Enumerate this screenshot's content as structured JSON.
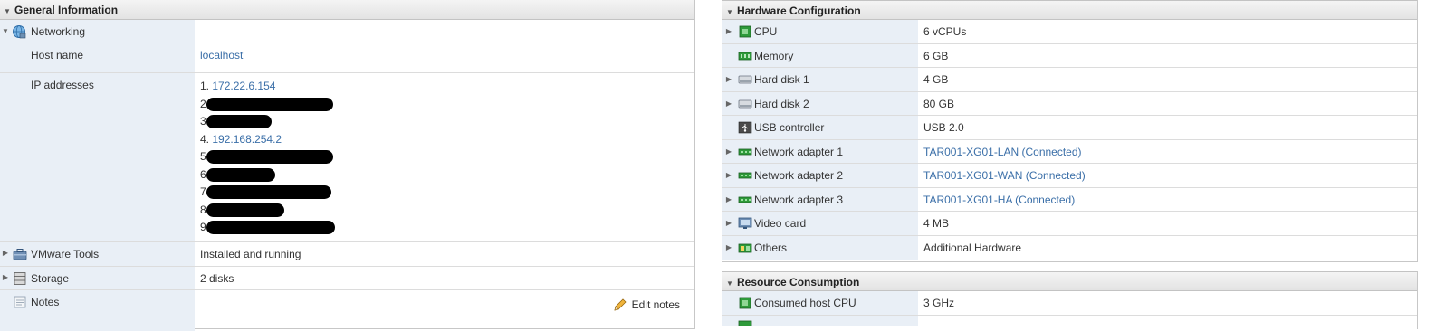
{
  "general": {
    "title": "General Information",
    "networking_label": "Networking",
    "host_name_label": "Host name",
    "host_name_value": "localhost",
    "ip_label": "IP addresses",
    "ip_prefixes": [
      "1.",
      "2.",
      "3.",
      "4.",
      "5.",
      "6.",
      "7.",
      "8.",
      "9."
    ],
    "ip_values": [
      "172.22.6.154",
      "",
      "",
      "192.168.254.2",
      "",
      "",
      "",
      "",
      ""
    ],
    "vmware_tools_label": "VMware Tools",
    "vmware_tools_value": "Installed and running",
    "storage_label": "Storage",
    "storage_value": "2 disks",
    "notes_label": "Notes",
    "edit_notes": "Edit notes"
  },
  "hardware": {
    "title": "Hardware Configuration",
    "rows": [
      {
        "label": "CPU",
        "value": "6 vCPUs",
        "icon": "cpu-icon",
        "expand": true,
        "link": false
      },
      {
        "label": "Memory",
        "value": "6 GB",
        "icon": "memory-icon",
        "expand": false,
        "link": false
      },
      {
        "label": "Hard disk 1",
        "value": "4 GB",
        "icon": "hard-disk-icon",
        "expand": true,
        "link": false
      },
      {
        "label": "Hard disk 2",
        "value": "80 GB",
        "icon": "hard-disk-icon",
        "expand": true,
        "link": false
      },
      {
        "label": "USB controller",
        "value": "USB 2.0",
        "icon": "usb-icon",
        "expand": false,
        "link": false
      },
      {
        "label": "Network adapter 1",
        "value": "TAR001-XG01-LAN (Connected)",
        "icon": "network-adapter-icon",
        "expand": true,
        "link": true
      },
      {
        "label": "Network adapter 2",
        "value": "TAR001-XG01-WAN (Connected)",
        "icon": "network-adapter-icon",
        "expand": true,
        "link": true
      },
      {
        "label": "Network adapter 3",
        "value": "TAR001-XG01-HA (Connected)",
        "icon": "network-adapter-icon",
        "expand": true,
        "link": true
      },
      {
        "label": "Video card",
        "value": "4 MB",
        "icon": "monitor-icon",
        "expand": true,
        "link": false
      },
      {
        "label": "Others",
        "value": "Additional Hardware",
        "icon": "others-icon",
        "expand": true,
        "link": false
      }
    ]
  },
  "resource": {
    "title": "Resource Consumption",
    "cpu_label": "Consumed host CPU",
    "cpu_value": "3 GHz"
  }
}
